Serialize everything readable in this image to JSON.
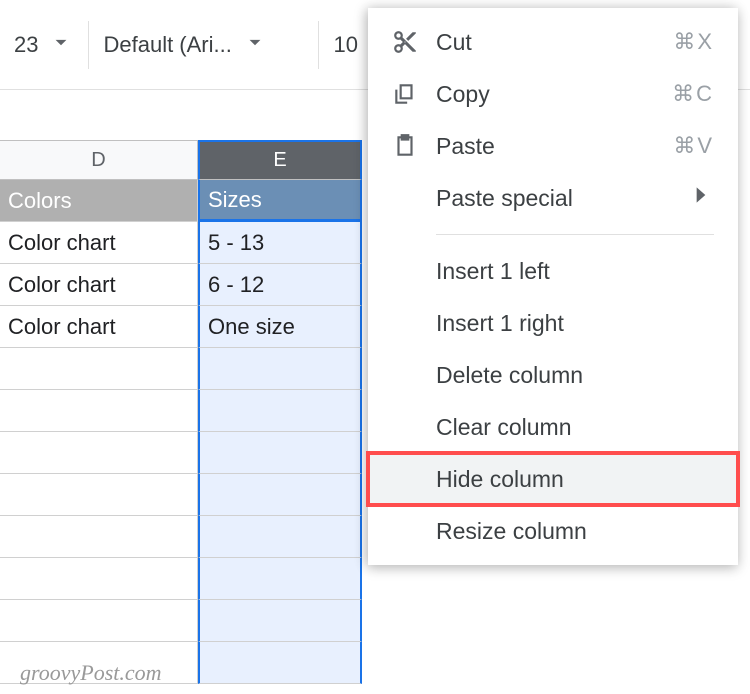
{
  "toolbar": {
    "format_label": "23",
    "font_label": "Default (Ari...",
    "font_size": "10"
  },
  "columns": {
    "d": "D",
    "e": "E"
  },
  "headers": {
    "colors": "Colors",
    "sizes": "Sizes"
  },
  "rows": [
    {
      "colors": "Color chart",
      "sizes": "5 - 13"
    },
    {
      "colors": "Color chart",
      "sizes": "6 - 12"
    },
    {
      "colors": "Color chart",
      "sizes": "One size"
    }
  ],
  "menu": {
    "cut": "Cut",
    "cut_shortcut": "⌘X",
    "copy": "Copy",
    "copy_shortcut": "⌘C",
    "paste": "Paste",
    "paste_shortcut": "⌘V",
    "paste_special": "Paste special",
    "insert_left": "Insert 1 left",
    "insert_right": "Insert 1 right",
    "delete_column": "Delete column",
    "clear_column": "Clear column",
    "hide_column": "Hide column",
    "resize_column": "Resize column"
  },
  "watermark": "groovyPost.com"
}
